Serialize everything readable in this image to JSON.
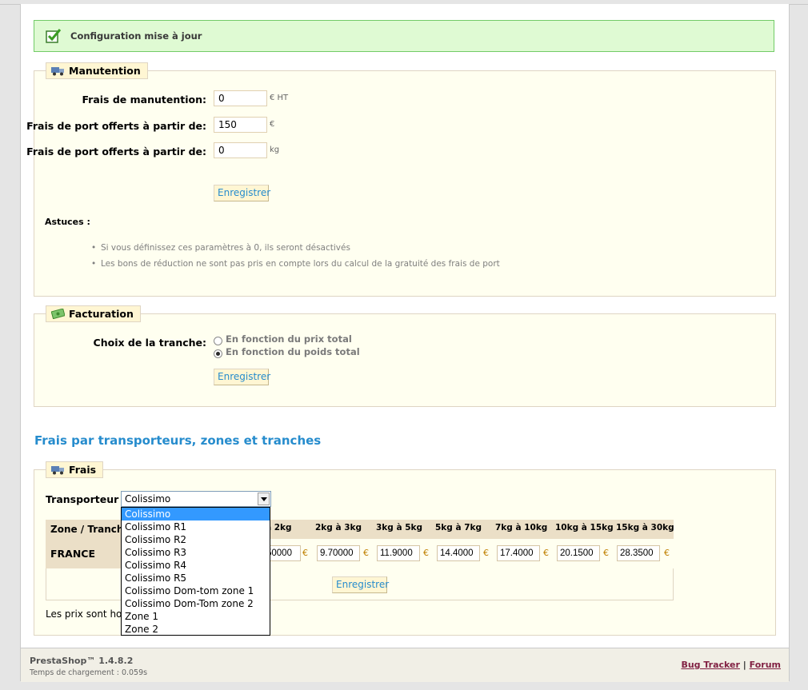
{
  "confirmation": "Configuration mise à jour",
  "manutention": {
    "legend": "Manutention",
    "fields": [
      {
        "label": "Frais de manutention:",
        "value": "0",
        "unit": "€ HT"
      },
      {
        "label": "Frais de port offerts à partir de:",
        "value": "150",
        "unit": "€"
      },
      {
        "label": "Frais de port offerts à partir de:",
        "value": "0",
        "unit": "kg"
      }
    ],
    "save": "Enregistrer",
    "tips_title": "Astuces :",
    "tips": [
      "Si vous définissez ces paramètres à 0, ils seront désactivés",
      "Les bons de réduction ne sont pas pris en compte lors du calcul de la gratuité des frais de port"
    ]
  },
  "facturation": {
    "legend": "Facturation",
    "label": "Choix de la tranche:",
    "options": [
      "En fonction du prix total",
      "En fonction du poids total"
    ],
    "selected_index": 1,
    "save": "Enregistrer"
  },
  "section_title": "Frais par transporteurs, zones et tranches",
  "frais": {
    "legend": "Frais",
    "carrier_label": "Transporteur :",
    "carrier_selected": "Colissimo",
    "carrier_options": [
      "Colissimo",
      "Colissimo R1",
      "Colissimo R2",
      "Colissimo R3",
      "Colissimo R4",
      "Colissimo R5",
      "Colissimo Dom-tom zone 1",
      "Colissimo Dom-Tom zone 2",
      "Zone 1",
      "Zone 2"
    ],
    "table": {
      "corner": "Zone / Tranch",
      "columns": [
        "à 2kg",
        "2kg à 3kg",
        "3kg à 5kg",
        "5kg à 7kg",
        "7kg à 10kg",
        "10kg à 15kg",
        "15kg à 30kg"
      ],
      "rows": [
        {
          "zone": "FRANCE",
          "values": [
            "50000",
            "9.70000",
            "11.9000",
            "14.4000",
            "17.4000",
            "20.1500",
            "28.3500"
          ],
          "currency": "€"
        }
      ]
    },
    "save": "Enregistrer",
    "note": "Les prix sont ho"
  },
  "footer": {
    "version": "PrestaShop™ 1.4.8.2",
    "load_time": "Temps de chargement : 0.059s",
    "bug_tracker": "Bug Tracker",
    "separator": "|",
    "forum": "Forum"
  },
  "colors": {
    "accent_blue": "#268ccd",
    "panel_bg": "#fffff0",
    "success_bg": "#dffad3",
    "link": "#812143"
  }
}
